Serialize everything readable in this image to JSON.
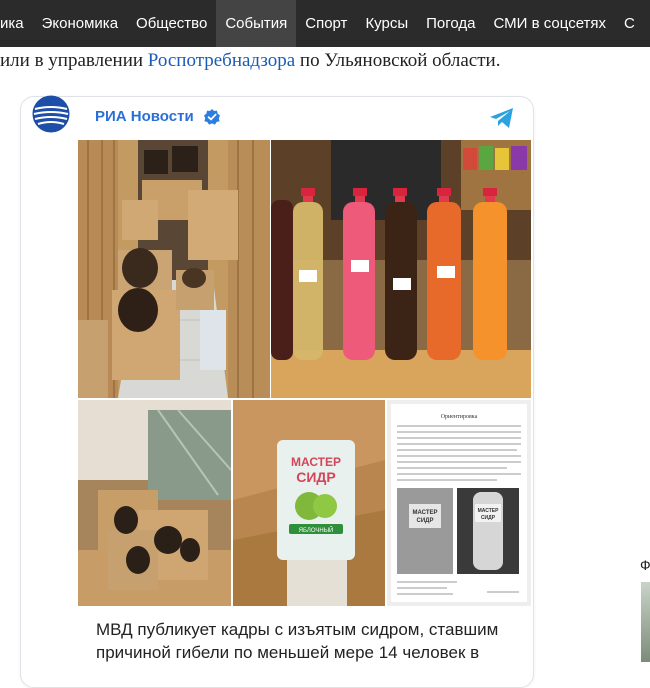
{
  "nav": {
    "items": [
      {
        "label": "ика"
      },
      {
        "label": "Экономика"
      },
      {
        "label": "Общество"
      },
      {
        "label": "События",
        "active": true
      },
      {
        "label": "Спорт"
      },
      {
        "label": "Курсы"
      },
      {
        "label": "Погода"
      },
      {
        "label": "СМИ в соцсетях"
      },
      {
        "label": "С"
      }
    ]
  },
  "article": {
    "intro_before": "или в управлении ",
    "intro_link": "Роспотребнадзора",
    "intro_after": " по Ульяновской области."
  },
  "embed": {
    "channel_name": "РИА Новости",
    "icons": [
      "ria-logo-icon",
      "verified-icon",
      "telegram-icon"
    ],
    "caption": "МВД публикует кадры с изъятым сидром, ставшим причиной гибели по меньшей мере 14 человек в"
  },
  "photos": {
    "label_line1": "МАСТЕР",
    "label_line2": "СИДР",
    "label_flavor": "ЯБЛОЧНЫЙ",
    "doc_heading": "Ориентировка",
    "doc_label_line1": "МАСТЕР",
    "doc_label_line2": "СИДР"
  },
  "sidebar": {
    "letter": "Ф"
  },
  "colors": {
    "nav_bg": "#2b2b2b",
    "nav_active_bg": "#444444",
    "link": "#1a5bb5",
    "channel_name": "#2a6fd6",
    "telegram": "#2aa3e0"
  }
}
